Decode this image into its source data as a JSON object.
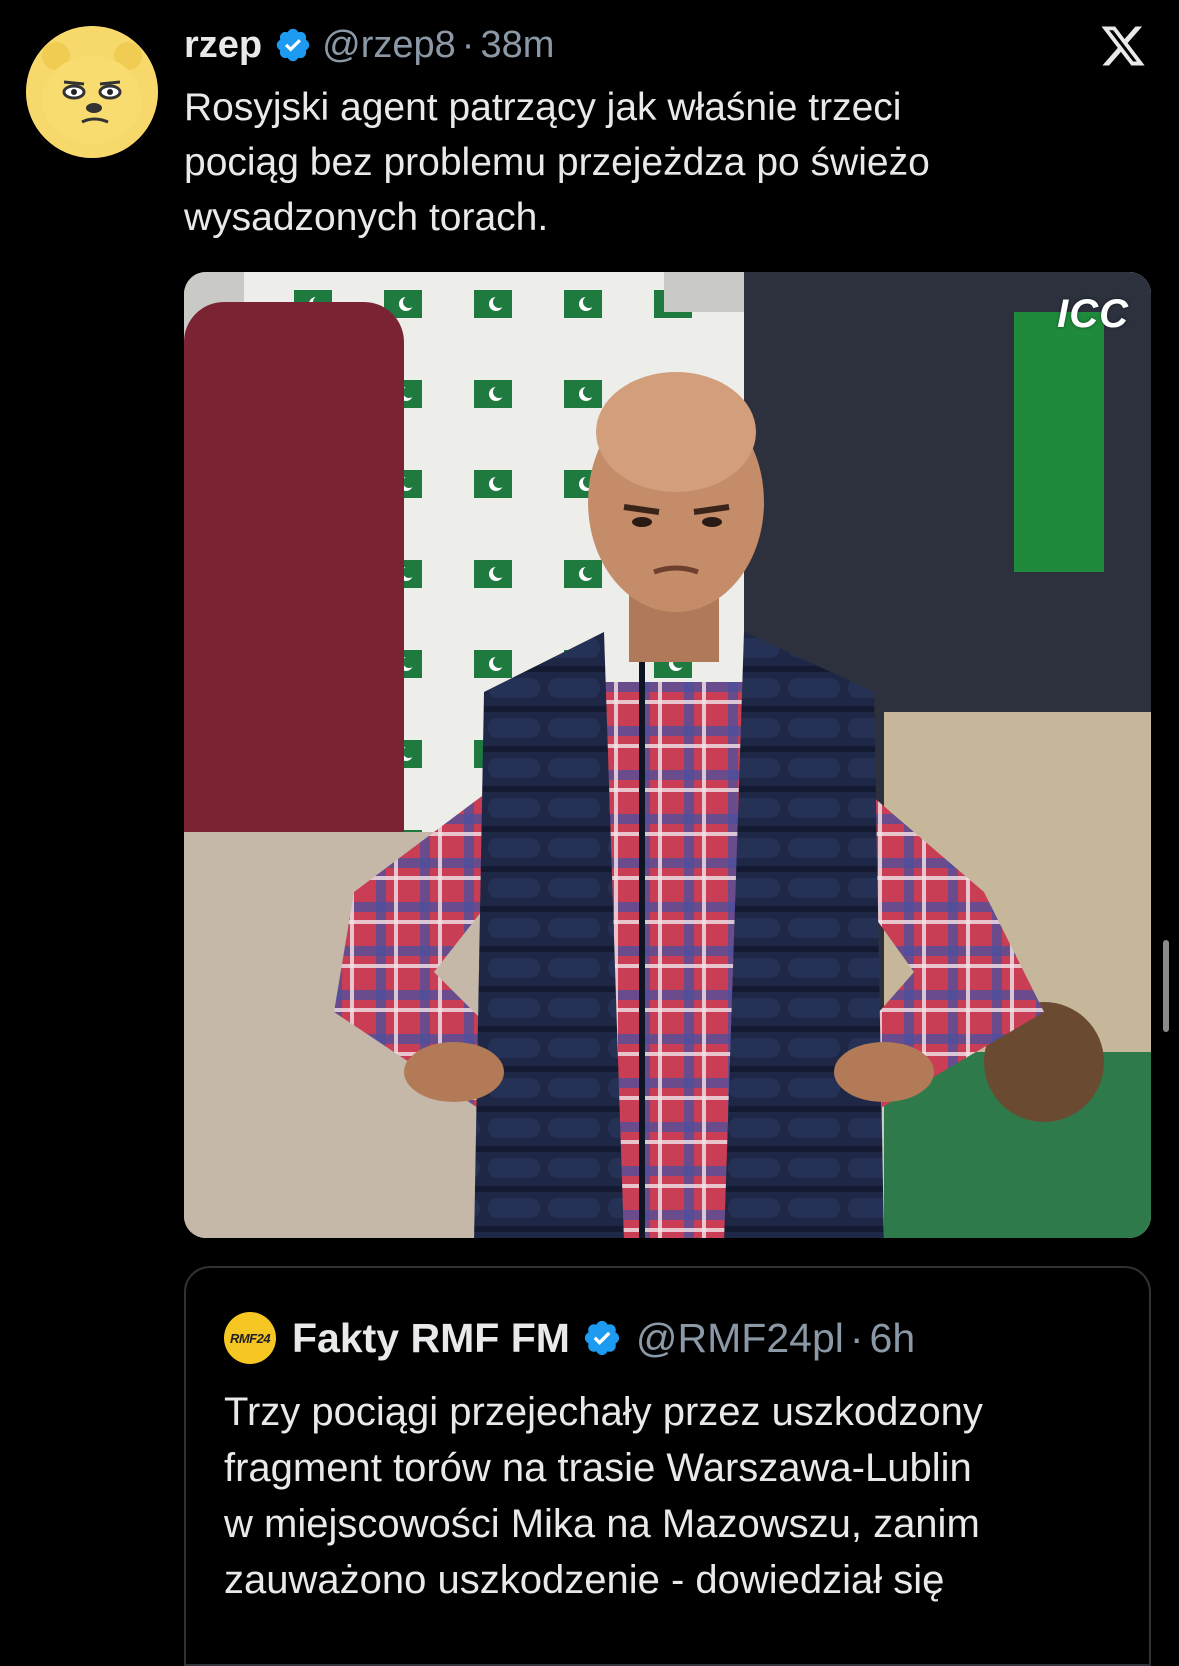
{
  "tweet": {
    "author_name": "rzep",
    "handle": "@rzep8",
    "separator": "·",
    "time": "38m",
    "text": "Rosyjski agent patrzący jak właśnie trzeci\npociąg bez problemu przejeżdza po świeżo\nwysadzonych torach.",
    "avatar_icon": "cartoon-bear-avatar",
    "verified_icon": "verified-badge-icon",
    "verified_color": "#1d9bf0",
    "media": {
      "icon": "meme-photo-disappointed-fan",
      "watermark": "ICC"
    }
  },
  "brand_logo": "x-logo-icon",
  "quoted_tweet": {
    "author_name": "Fakty RMF FM",
    "avatar_text": "RMF24",
    "handle": "@RMF24pl",
    "separator": "·",
    "time": "6h",
    "text": "Trzy pociągi przejechały przez uszkodzony\nfragment torów na trasie Warszawa-Lublin\nw miejscowości Mika na Mazowszu, zanim\nzauważono uszkodzenie - dowiedział się"
  },
  "colors": {
    "background": "#000000",
    "text": "#e7e9ea",
    "secondary_text": "#8b98a5",
    "border": "#2f3336"
  }
}
